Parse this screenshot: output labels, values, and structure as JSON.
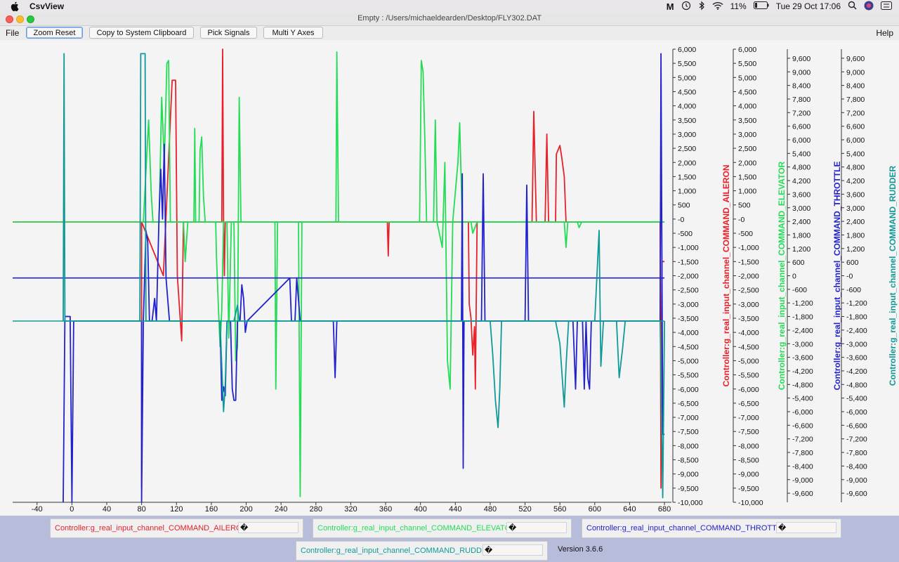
{
  "menubar": {
    "app_name": "CsvView",
    "clock": "Tue 29 Oct  17:06",
    "battery": "11%",
    "status_icons": [
      "maltego-icon",
      "time-machine-icon",
      "bluetooth-icon",
      "wifi-icon",
      "battery-icon",
      "search-icon",
      "siri-icon",
      "control-center-icon"
    ]
  },
  "window": {
    "title": "Empty : /Users/michaeldearden/Desktop/FLY302.DAT"
  },
  "toolbar": {
    "file_menu": "File",
    "help_menu": "Help",
    "zoom_reset": "Zoom Reset",
    "copy_clipboard": "Copy to System Clipboard",
    "pick_signals": "Pick Signals",
    "multi_y_axes": "Multi Y Axes"
  },
  "chart_data": {
    "type": "line",
    "title": "",
    "x_ticks": [
      "-40",
      "0",
      "40",
      "80",
      "120",
      "160",
      "200",
      "240",
      "280",
      "320",
      "360",
      "400",
      "440",
      "480",
      "520",
      "560",
      "600",
      "640",
      "680"
    ],
    "xlim": [
      -68,
      688
    ],
    "axes": [
      {
        "label": "Controller:g_real_input_channel_COMMAND_AILERON",
        "color": "#e8202a",
        "ylim": [
          -10000,
          6000
        ],
        "ticks": [
          "6,000",
          "5,500",
          "5,000",
          "4,500",
          "4,000",
          "3,500",
          "3,000",
          "2,500",
          "2,000",
          "1,500",
          "1,000",
          "500",
          "-0",
          "-500",
          "-1,000",
          "-1,500",
          "-2,000",
          "-2,500",
          "-3,000",
          "-3,500",
          "-4,000",
          "-4,500",
          "-5,000",
          "-5,500",
          "-6,000",
          "-6,500",
          "-7,000",
          "-7,500",
          "-8,000",
          "-8,500",
          "-9,000",
          "-9,500",
          "-10,000"
        ]
      },
      {
        "label": "Controller:g_real_input_channel_COMMAND_ELEVATOR",
        "color": "#22dd55",
        "ylim": [
          -10000,
          6000
        ],
        "ticks": [
          "6,000",
          "5,500",
          "5,000",
          "4,500",
          "4,000",
          "3,500",
          "3,000",
          "2,500",
          "2,000",
          "1,500",
          "1,000",
          "500",
          "-0",
          "-500",
          "-1,000",
          "-1,500",
          "-2,000",
          "-2,500",
          "-3,000",
          "-3,500",
          "-4,000",
          "-4,500",
          "-5,000",
          "-5,500",
          "-6,000",
          "-6,500",
          "-7,000",
          "-7,500",
          "-8,000",
          "-8,500",
          "-9,000",
          "-9,500",
          "-10,000"
        ]
      },
      {
        "label": "Controller:g_real_input_channel_COMMAND_THROTTLE",
        "color": "#2222cc",
        "ylim": [
          -10000,
          10000
        ],
        "ticks": [
          "9,600",
          "9,000",
          "8,400",
          "7,800",
          "7,200",
          "6,600",
          "6,000",
          "5,400",
          "4,800",
          "4,200",
          "3,600",
          "3,000",
          "2,400",
          "1,800",
          "1,200",
          "600",
          "0",
          "-600",
          "-1,200",
          "-1,800",
          "-2,400",
          "-3,000",
          "-3,600",
          "-4,200",
          "-4,800",
          "-5,400",
          "-6,000",
          "-6,600",
          "-7,200",
          "-7,800",
          "-8,400",
          "-9,000",
          "-9,600"
        ]
      },
      {
        "label": "Controller:g_real_input_channel_COMMAND_RUDDER",
        "color": "#119999",
        "ylim": [
          -10000,
          10000
        ],
        "ticks": [
          "9,600",
          "9,000",
          "8,400",
          "7,800",
          "7,200",
          "6,600",
          "6,000",
          "5,400",
          "4,800",
          "4,200",
          "3,600",
          "3,000",
          "2,400",
          "1,800",
          "1,200",
          "600",
          "-0",
          "-600",
          "-1,200",
          "-1,800",
          "-2,400",
          "-3,000",
          "-3,600",
          "-4,200",
          "-4,800",
          "-5,400",
          "-6,000",
          "-6,600",
          "-7,200",
          "-7,800",
          "-8,400",
          "-9,000",
          "-9,600"
        ]
      }
    ],
    "series": [
      {
        "name": "Controller:g_real_input_channel_COMMAND_AILERON",
        "axis": 0,
        "color": "#e8202a",
        "baseline": -100,
        "segments": [
          [
            80,
            -9500
          ],
          [
            80,
            -100
          ],
          [
            105,
            -2000
          ],
          [
            115,
            4900
          ],
          [
            119,
            4900
          ],
          [
            121,
            -2000
          ],
          [
            126,
            -4300
          ],
          [
            128,
            -100
          ],
          [
            172,
            -100
          ],
          [
            173,
            6000
          ],
          [
            174,
            -100
          ],
          [
            175,
            -2000
          ],
          [
            176,
            -100
          ],
          [
            362,
            -100
          ],
          [
            363,
            -1300
          ],
          [
            364,
            -100
          ],
          [
            455,
            -100
          ],
          [
            456,
            -3000
          ],
          [
            458,
            -3500
          ],
          [
            460,
            -4800
          ],
          [
            462,
            -3800
          ],
          [
            463,
            -6000
          ],
          [
            465,
            -100
          ],
          [
            528,
            -100
          ],
          [
            530,
            3800
          ],
          [
            533,
            -100
          ],
          [
            538,
            -100
          ],
          [
            543,
            -100
          ],
          [
            545,
            3000
          ],
          [
            547,
            -100
          ],
          [
            555,
            -100
          ],
          [
            556,
            2300
          ],
          [
            560,
            2600
          ],
          [
            562,
            2200
          ],
          [
            565,
            1500
          ],
          [
            567,
            -100
          ],
          [
            570,
            -100
          ],
          [
            575,
            -100
          ],
          [
            675,
            -100
          ],
          [
            676,
            -9500
          ],
          [
            677,
            -1500
          ],
          [
            680,
            -1500
          ]
        ]
      },
      {
        "name": "Controller:g_real_input_channel_COMMAND_ELEVATOR",
        "axis": 1,
        "color": "#22dd55",
        "baseline": -100,
        "segments": [
          [
            80,
            -100
          ],
          [
            82,
            -100
          ],
          [
            88,
            3500
          ],
          [
            91,
            900
          ],
          [
            93,
            -100
          ],
          [
            97,
            -100
          ],
          [
            100,
            -100
          ],
          [
            103,
            4300
          ],
          [
            106,
            2000
          ],
          [
            109,
            5500
          ],
          [
            111,
            5600
          ],
          [
            113,
            -100
          ],
          [
            121,
            -100
          ],
          [
            125,
            -100
          ],
          [
            128,
            -100
          ],
          [
            130,
            -1500
          ],
          [
            133,
            -100
          ],
          [
            140,
            -100
          ],
          [
            141,
            3200
          ],
          [
            142,
            -100
          ],
          [
            146,
            -100
          ],
          [
            147,
            2400
          ],
          [
            149,
            2900
          ],
          [
            151,
            800
          ],
          [
            153,
            -100
          ],
          [
            165,
            -100
          ],
          [
            166,
            -1400
          ],
          [
            168,
            -3000
          ],
          [
            170,
            -4500
          ],
          [
            172,
            -3200
          ],
          [
            174,
            -100
          ],
          [
            178,
            -100
          ],
          [
            180,
            -4200
          ],
          [
            183,
            -100
          ],
          [
            186,
            -100
          ],
          [
            188,
            -5000
          ],
          [
            190,
            -4500
          ],
          [
            192,
            4300
          ],
          [
            194,
            -100
          ],
          [
            233,
            -100
          ],
          [
            234,
            -6000
          ],
          [
            236,
            -100
          ],
          [
            260,
            -100
          ],
          [
            262,
            -9800
          ],
          [
            264,
            -100
          ],
          [
            303,
            -100
          ],
          [
            304,
            5900
          ],
          [
            306,
            -100
          ],
          [
            399,
            -100
          ],
          [
            401,
            5600
          ],
          [
            403,
            5200
          ],
          [
            405,
            2800
          ],
          [
            407,
            -100
          ],
          [
            415,
            -100
          ],
          [
            417,
            3500
          ],
          [
            419,
            -100
          ],
          [
            425,
            -1000
          ],
          [
            428,
            2000
          ],
          [
            431,
            -5000
          ],
          [
            434,
            -6000
          ],
          [
            437,
            -100
          ],
          [
            443,
            2000
          ],
          [
            445,
            3400
          ],
          [
            448,
            -100
          ],
          [
            450,
            -100
          ],
          [
            453,
            -100
          ],
          [
            458,
            -100
          ],
          [
            460,
            -500
          ],
          [
            465,
            -100
          ],
          [
            468,
            -100
          ],
          [
            473,
            -100
          ],
          [
            480,
            -100
          ],
          [
            565,
            -100
          ],
          [
            567,
            -1000
          ],
          [
            569,
            -100
          ],
          [
            580,
            -100
          ],
          [
            582,
            -300
          ],
          [
            585,
            -100
          ],
          [
            675,
            -100
          ]
        ]
      },
      {
        "name": "Controller:g_real_input_channel_COMMAND_THROTTLE",
        "axis": 2,
        "color": "#2222cc",
        "baseline": -100,
        "segments": [
          [
            -10,
            -10000
          ],
          [
            -8,
            -1800
          ],
          [
            -6,
            -1800
          ],
          [
            -4,
            -1800
          ],
          [
            -2,
            -1800
          ],
          [
            0,
            -10000
          ],
          [
            2,
            -2000
          ],
          [
            80,
            -2000
          ],
          [
            80,
            -10000
          ],
          [
            82,
            -2000
          ],
          [
            85,
            2000
          ],
          [
            87,
            1500
          ],
          [
            89,
            -2000
          ],
          [
            92,
            -2000
          ],
          [
            95,
            -1000
          ],
          [
            97,
            -2000
          ],
          [
            100,
            2600
          ],
          [
            102,
            4700
          ],
          [
            104,
            2500
          ],
          [
            106,
            5800
          ],
          [
            108,
            -100
          ],
          [
            112,
            -2000
          ],
          [
            170,
            -2000
          ],
          [
            172,
            -5500
          ],
          [
            174,
            -4900
          ],
          [
            176,
            -5300
          ],
          [
            178,
            -2000
          ],
          [
            182,
            -2000
          ],
          [
            184,
            -5000
          ],
          [
            186,
            -5500
          ],
          [
            188,
            -5500
          ],
          [
            190,
            -2000
          ],
          [
            193,
            -2000
          ],
          [
            195,
            -400
          ],
          [
            197,
            -1000
          ],
          [
            199,
            -2500
          ],
          [
            201,
            -2000
          ],
          [
            250,
            -100
          ],
          [
            252,
            -2000
          ],
          [
            256,
            -2000
          ],
          [
            258,
            -100
          ],
          [
            262,
            -2000
          ],
          [
            300,
            -2000
          ],
          [
            302,
            -4500
          ],
          [
            304,
            -2000
          ],
          [
            360,
            -2000
          ],
          [
            447,
            -2000
          ],
          [
            448,
            4500
          ],
          [
            449,
            -8500
          ],
          [
            450,
            -2000
          ],
          [
            470,
            -2000
          ],
          [
            472,
            4500
          ],
          [
            474,
            -2000
          ],
          [
            520,
            -2000
          ],
          [
            522,
            4000
          ],
          [
            524,
            -2000
          ],
          [
            575,
            -2000
          ],
          [
            578,
            -5000
          ],
          [
            580,
            -2000
          ],
          [
            586,
            -2000
          ],
          [
            588,
            -5000
          ],
          [
            590,
            -2000
          ],
          [
            592,
            -4500
          ],
          [
            594,
            -5000
          ],
          [
            596,
            -2000
          ],
          [
            675,
            -2000
          ],
          [
            676,
            9800
          ],
          [
            678,
            -7000
          ],
          [
            680,
            -7000
          ]
        ]
      },
      {
        "name": "Controller:g_real_input_channel_COMMAND_RUDDER",
        "axis": 3,
        "color": "#119999",
        "baseline": -2000,
        "segments": [
          [
            -10,
            -2000
          ],
          [
            -9,
            9800
          ],
          [
            -8,
            -2000
          ],
          [
            78,
            -2000
          ],
          [
            79,
            9800
          ],
          [
            84,
            9800
          ],
          [
            85,
            -2000
          ],
          [
            170,
            -2000
          ],
          [
            172,
            -4000
          ],
          [
            174,
            -6000
          ],
          [
            176,
            -4800
          ],
          [
            178,
            -2000
          ],
          [
            186,
            -2000
          ],
          [
            190,
            -1300
          ],
          [
            192,
            -2000
          ],
          [
            480,
            -2000
          ],
          [
            483,
            -3500
          ],
          [
            486,
            -5500
          ],
          [
            489,
            -6700
          ],
          [
            491,
            -5000
          ],
          [
            493,
            -2000
          ],
          [
            555,
            -2000
          ],
          [
            560,
            -3000
          ],
          [
            565,
            -5800
          ],
          [
            567,
            -4000
          ],
          [
            570,
            -2000
          ],
          [
            600,
            -2000
          ],
          [
            605,
            2000
          ],
          [
            607,
            -4000
          ],
          [
            610,
            -2000
          ],
          [
            625,
            -2000
          ],
          [
            628,
            -4500
          ],
          [
            632,
            -3200
          ],
          [
            635,
            -2000
          ],
          [
            675,
            -2000
          ],
          [
            678,
            -9800
          ],
          [
            680,
            -2000
          ]
        ]
      }
    ],
    "legend": [
      "Controller:g_real_input_channel_COMMAND_AILERON",
      "Controller:g_real_input_channel_COMMAND_ELEVATOR",
      "Controller:g_real_input_channel_COMMAND_THROTTLE",
      "Controller:g_real_input_channel_COMMAND_RUDDER"
    ],
    "grid": false
  },
  "signals": [
    {
      "label": "Controller:g_real_input_channel_COMMAND_AILERON",
      "value": "�",
      "color": "#e8202a"
    },
    {
      "label": "Controller:g_real_input_channel_COMMAND_ELEVATOR",
      "value": "�",
      "color": "#22dd55"
    },
    {
      "label": "Controller:g_real_input_channel_COMMAND_THROTTLE",
      "value": "�",
      "color": "#2222cc"
    },
    {
      "label": "Controller:g_real_input_channel_COMMAND_RUDDER",
      "value": "�",
      "color": "#119999"
    }
  ],
  "footer": {
    "version": "Version 3.6.6"
  }
}
